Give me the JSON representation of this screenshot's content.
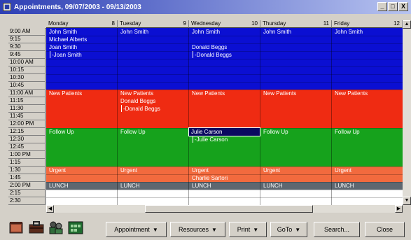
{
  "window": {
    "title": "Appointments, 09/07/2003 - 09/13/2003"
  },
  "titlebar_buttons": {
    "minimize": "_",
    "maximize": "□",
    "close": "X"
  },
  "days": [
    {
      "name": "Monday",
      "date": "8"
    },
    {
      "name": "Tuesday",
      "date": "9"
    },
    {
      "name": "Wednesday",
      "date": "10"
    },
    {
      "name": "Thursday",
      "date": "11"
    },
    {
      "name": "Friday",
      "date": "12"
    }
  ],
  "times": [
    "9:00 AM",
    "9:15",
    "9:30",
    "9:45",
    "10:00 AM",
    "10:15",
    "10:30",
    "10:45",
    "11:00 AM",
    "11:15",
    "11:30",
    "11:45",
    "12:00 PM",
    "12:15",
    "12:30",
    "12:45",
    "1:00 PM",
    "1:15",
    "1:30",
    "1:45",
    "2:00 PM",
    "2:15",
    "2:30"
  ],
  "colors": {
    "blue": "#0b0fd2",
    "red": "#ef2b12",
    "green": "#16a21c",
    "orange": "#f26a3e",
    "gray": "#5e6770"
  },
  "appointments": {
    "mon_1": "John Smith",
    "mon_2": "Michael Alberts",
    "mon_3": "Joan Smith",
    "mon_4": "Joan Smith",
    "tue_1": "John Smith",
    "wed_1": "John Smith",
    "wed_2": "Donald Beggs",
    "wed_3": "Donald Beggs",
    "thu_1": "John Smith",
    "fri_1": "John Smith",
    "tue_np2": "Donald Beggs",
    "tue_np3": "Donald Beggs",
    "wed_fu1": "Julie Carson",
    "wed_fu2": "Julie Carson",
    "wed_urg2": "Charlie Sartori"
  },
  "bands": {
    "new_patients": "New Patients",
    "follow_up": "Follow Up",
    "urgent": "Urgent",
    "lunch": "LUNCH"
  },
  "toolbar": {
    "appointment": "Appointment",
    "resources": "Resources",
    "print": "Print",
    "goto": "GoTo",
    "search": "Search...",
    "close": "Close"
  }
}
